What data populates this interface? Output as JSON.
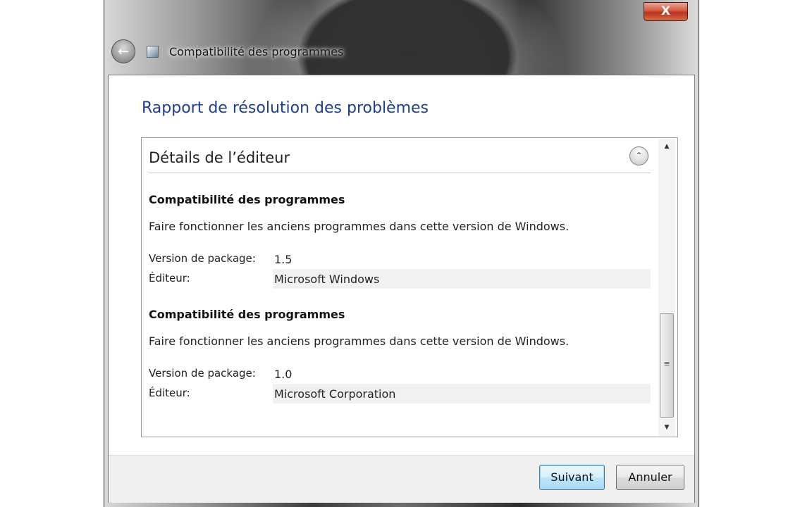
{
  "window": {
    "title": "Compatibilité des programmes",
    "close_glyph": "X",
    "back_glyph": "←"
  },
  "page": {
    "heading": "Rapport de résolution des problèmes"
  },
  "details": {
    "section_title": "Détails de l’éditeur",
    "collapse_glyph": "⌃",
    "packages": [
      {
        "name": "Compatibilité des programmes",
        "description": "Faire fonctionner les anciens programmes dans cette version de Windows.",
        "version_label": "Version de package:",
        "version": "1.5",
        "publisher_label": "Éditeur:",
        "publisher": "Microsoft Windows"
      },
      {
        "name": "Compatibilité des programmes",
        "description": "Faire fonctionner les anciens programmes dans cette version de Windows.",
        "version_label": "Version de package:",
        "version": "1.0",
        "publisher_label": "Éditeur:",
        "publisher": "Microsoft Corporation"
      }
    ]
  },
  "scrollbar": {
    "up_glyph": "▲",
    "down_glyph": "▼",
    "grip_glyph": "≡"
  },
  "footer": {
    "next_label": "Suivant",
    "cancel_label": "Annuler"
  }
}
